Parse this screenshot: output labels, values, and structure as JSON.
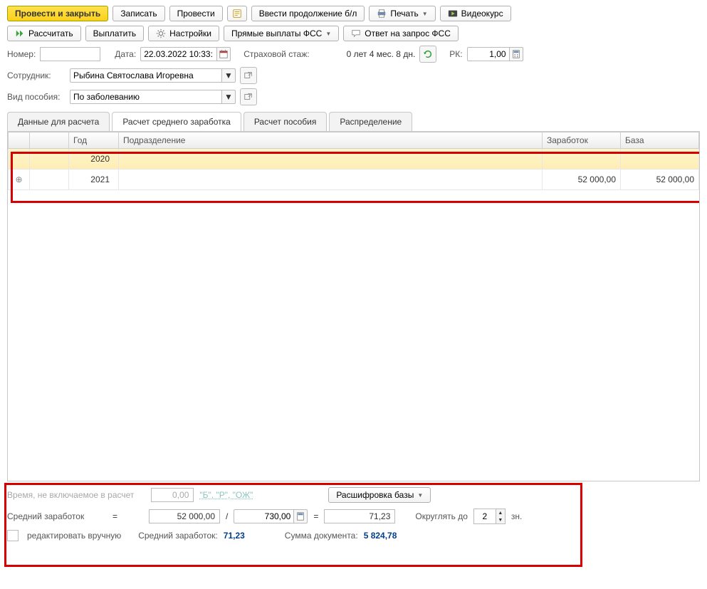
{
  "toolbar1": {
    "post_close": "Провести и закрыть",
    "save": "Записать",
    "post": "Провести",
    "continuation": "Ввести продолжение б/л",
    "print": "Печать",
    "video": "Видеокурс"
  },
  "toolbar2": {
    "calc": "Рассчитать",
    "pay": "Выплатить",
    "settings": "Настройки",
    "fss_direct": "Прямые выплаты ФСС",
    "fss_answer": "Ответ на запрос ФСС"
  },
  "header": {
    "number_label": "Номер:",
    "number_value": "",
    "date_label": "Дата:",
    "date_value": "22.03.2022 10:33:",
    "stage_label": "Страховой стаж:",
    "stage_value": "0 лет 4 мес. 8 дн.",
    "rk_label": "РК:",
    "rk_value": "1,00",
    "employee_label": "Сотрудник:",
    "employee_value": "Рыбина Святослава Игоревна",
    "kind_label": "Вид пособия:",
    "kind_value": "По заболеванию"
  },
  "tabs": {
    "t1": "Данные для расчета",
    "t2": "Расчет среднего заработка",
    "t3": "Расчет пособия",
    "t4": "Распределение"
  },
  "grid": {
    "col_year": "Год",
    "col_dept": "Подразделение",
    "col_earn": "Заработок",
    "col_base": "База",
    "rows": [
      {
        "year": "2020",
        "dept": "",
        "earn": "",
        "base": ""
      },
      {
        "year": "2021",
        "dept": "",
        "earn": "52 000,00",
        "base": "52 000,00"
      }
    ]
  },
  "footer": {
    "exclude_label": "Время, не включаемое в расчет",
    "exclude_value": "0,00",
    "codes_link": "\"Б\", \"Р\", \"ОЖ\"",
    "decode_btn": "Расшифровка базы",
    "avg_label": "Средний заработок",
    "eq": "=",
    "sum1": "52 000,00",
    "divider": "/",
    "days": "730,00",
    "avg_result": "71,23",
    "round_label": "Округлять до",
    "round_val": "2",
    "round_unit": "зн.",
    "manual_edit": "редактировать вручную",
    "avg_earn2": "Средний заработок:",
    "avg_earn2_val": "71,23",
    "doc_sum_label": "Сумма документа:",
    "doc_sum_val": "5 824,78"
  }
}
